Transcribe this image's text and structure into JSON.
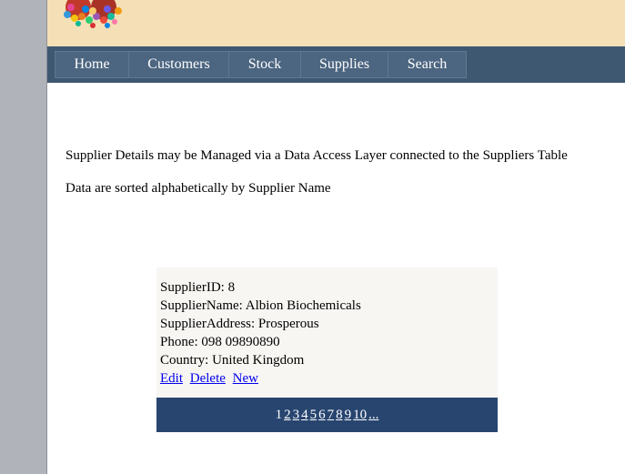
{
  "nav": {
    "items": [
      "Home",
      "Customers",
      "Stock",
      "Supplies",
      "Search"
    ]
  },
  "intro": {
    "line1": "Supplier Details may be Managed via a Data Access Layer connected to the Suppliers Table",
    "line2": "Data are sorted alphabetically by Supplier Name"
  },
  "record": {
    "supplier_id": "SupplierID: 8",
    "supplier_name": "SupplierName: Albion Biochemicals",
    "supplier_address": "SupplierAddress: Prosperous",
    "phone": "Phone: 098 09890890",
    "country": "Country: United Kingdom"
  },
  "actions": {
    "edit": "Edit",
    "delete": "Delete",
    "new": "New"
  },
  "pager": {
    "current": "1",
    "pages": [
      "2",
      "3",
      "4",
      "5",
      "6",
      "7",
      "8",
      "9",
      "10"
    ],
    "more": "..."
  },
  "colors": {
    "header_bg": "#f5dfb6",
    "nav_bg": "#3e5871",
    "pager_bg": "#284570",
    "link": "#0000ee"
  },
  "icons": {
    "logo": "molecule-logo-icon"
  }
}
